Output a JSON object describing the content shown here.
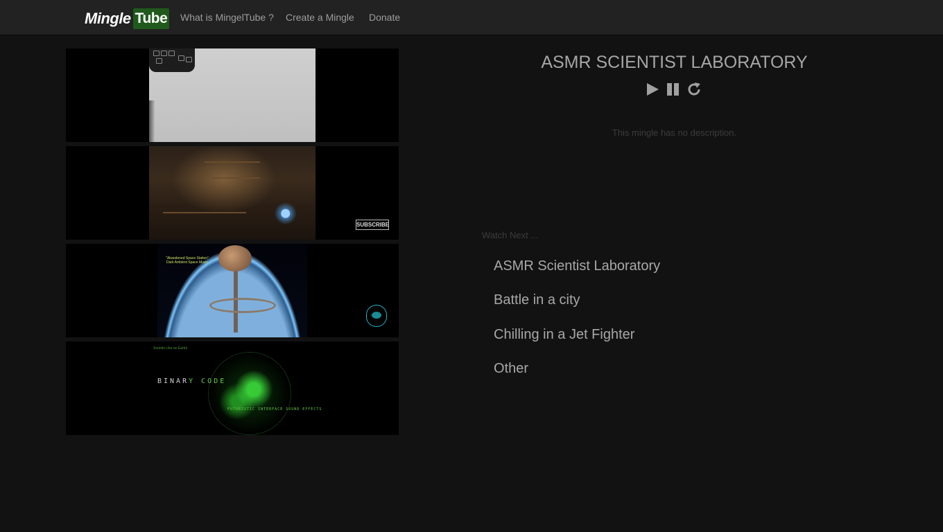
{
  "brand": {
    "logo_mingle": "Mingle",
    "logo_tube": "Tube"
  },
  "nav": {
    "items": [
      {
        "label": "What is MingelTube ?"
      },
      {
        "label": "Create a Mingle"
      },
      {
        "label": "Donate"
      }
    ]
  },
  "videos": [
    {
      "name": "lab-hands-video"
    },
    {
      "name": "scientist-laboratory-video",
      "overlay_label": "SUBSCRIBE"
    },
    {
      "name": "space-station-video",
      "caption": "\"Abandoned Space Station\" Dark Ambient Space Music"
    },
    {
      "name": "binary-code-video",
      "title_main": "BINAR",
      "title_accent": "Y CODE",
      "subtitle": "FUTURISTIC INTERFACE SOUND EFFECTS",
      "channel": "Sounds Like an Earful"
    }
  ],
  "mingle": {
    "title": "ASMR SCIENTIST LABORATORY",
    "description": "This mingle has no description.",
    "controls": [
      "play-icon",
      "pause-icon",
      "replay-icon"
    ]
  },
  "watch_next": {
    "label": "Watch Next ...",
    "items": [
      {
        "label": "ASMR Scientist Laboratory"
      },
      {
        "label": "Battle in a city"
      },
      {
        "label": "Chilling in a Jet Fighter"
      },
      {
        "label": "Other"
      }
    ]
  },
  "colors": {
    "background": "#121212",
    "navbar": "#222222",
    "logo_tube_bg": "#1f5a1c",
    "text_primary": "#a6a6a6",
    "text_muted": "#3c3c3c"
  }
}
